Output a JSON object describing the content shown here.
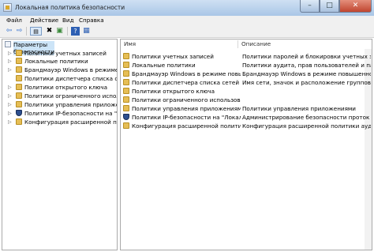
{
  "window": {
    "title": "Локальная политика безопасности"
  },
  "menu": [
    "Файл",
    "Действие",
    "Вид",
    "Справка"
  ],
  "toolbar": {
    "buttons": [
      "back-arrow-icon",
      "forward-arrow-icon",
      "console-tree-icon",
      "delete-icon",
      "export-list-icon",
      "help-icon",
      "properties-icon"
    ]
  },
  "tree": {
    "root": "Параметры безопасности",
    "items": [
      {
        "label": "Политики учетных записей",
        "icon": "folder"
      },
      {
        "label": "Локальные политики",
        "icon": "folder"
      },
      {
        "label": "Брандмауэр Windows в режиме пов",
        "icon": "folder"
      },
      {
        "label": "Политики диспетчера списка сетей",
        "icon": "folder"
      },
      {
        "label": "Политики открытого ключа",
        "icon": "folder"
      },
      {
        "label": "Политики ограниченного использо",
        "icon": "folder"
      },
      {
        "label": "Политики управления приложения",
        "icon": "folder"
      },
      {
        "label": "Политики IP-безопасности на \"Лок",
        "icon": "shield"
      },
      {
        "label": "Конфигурация расширенной полит",
        "icon": "folder"
      }
    ]
  },
  "list": {
    "columns": [
      "Имя",
      "Описание"
    ],
    "rows": [
      {
        "name": "Политики учетных записей",
        "desc": "Политики паролей и блокировки учетных за",
        "icon": "folder"
      },
      {
        "name": "Локальные политики",
        "desc": "Политики аудита, прав пользователей и пар",
        "icon": "folder"
      },
      {
        "name": "Брандмауэр Windows в режиме повы...",
        "desc": "Брандмауэр Windows в режиме повышенно",
        "icon": "folder"
      },
      {
        "name": "Политики диспетчера списка сетей",
        "desc": "Имя сети, значок и расположение группов",
        "icon": "folder"
      },
      {
        "name": "Политики открытого ключа",
        "desc": "",
        "icon": "folder"
      },
      {
        "name": "Политики ограниченного использов...",
        "desc": "",
        "icon": "folder"
      },
      {
        "name": "Политики управления приложениями",
        "desc": "Политики управления приложениями",
        "icon": "folder"
      },
      {
        "name": "Политики IP-безопасности на \"Локаль...",
        "desc": "Администрирование безопасности проток",
        "icon": "shield"
      },
      {
        "name": "Конфигурация расширенной политик...",
        "desc": "Конфигурация расширенной политики ауди",
        "icon": "folder"
      }
    ]
  }
}
